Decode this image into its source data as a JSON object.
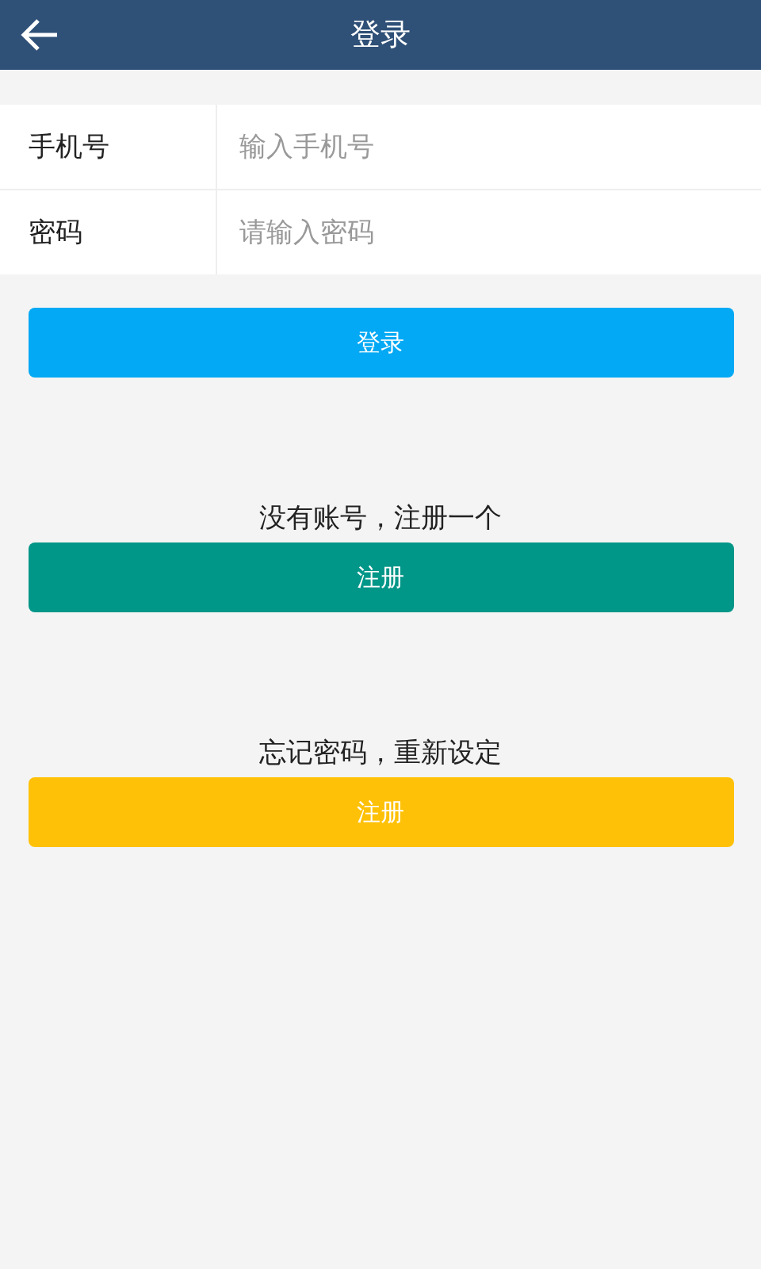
{
  "header": {
    "title": "登录"
  },
  "fields": [
    {
      "label": "手机号",
      "placeholder": "输入手机号"
    },
    {
      "label": "密码",
      "placeholder": "请输入密码"
    }
  ],
  "login_button": {
    "label": "登录",
    "color": "#03a9f4"
  },
  "sections": [
    {
      "prompt": "没有账号，注册一个",
      "button": "注册",
      "color": "#009688"
    },
    {
      "prompt": "忘记密码，重新设定",
      "button": "注册",
      "color": "#ffc107"
    }
  ]
}
